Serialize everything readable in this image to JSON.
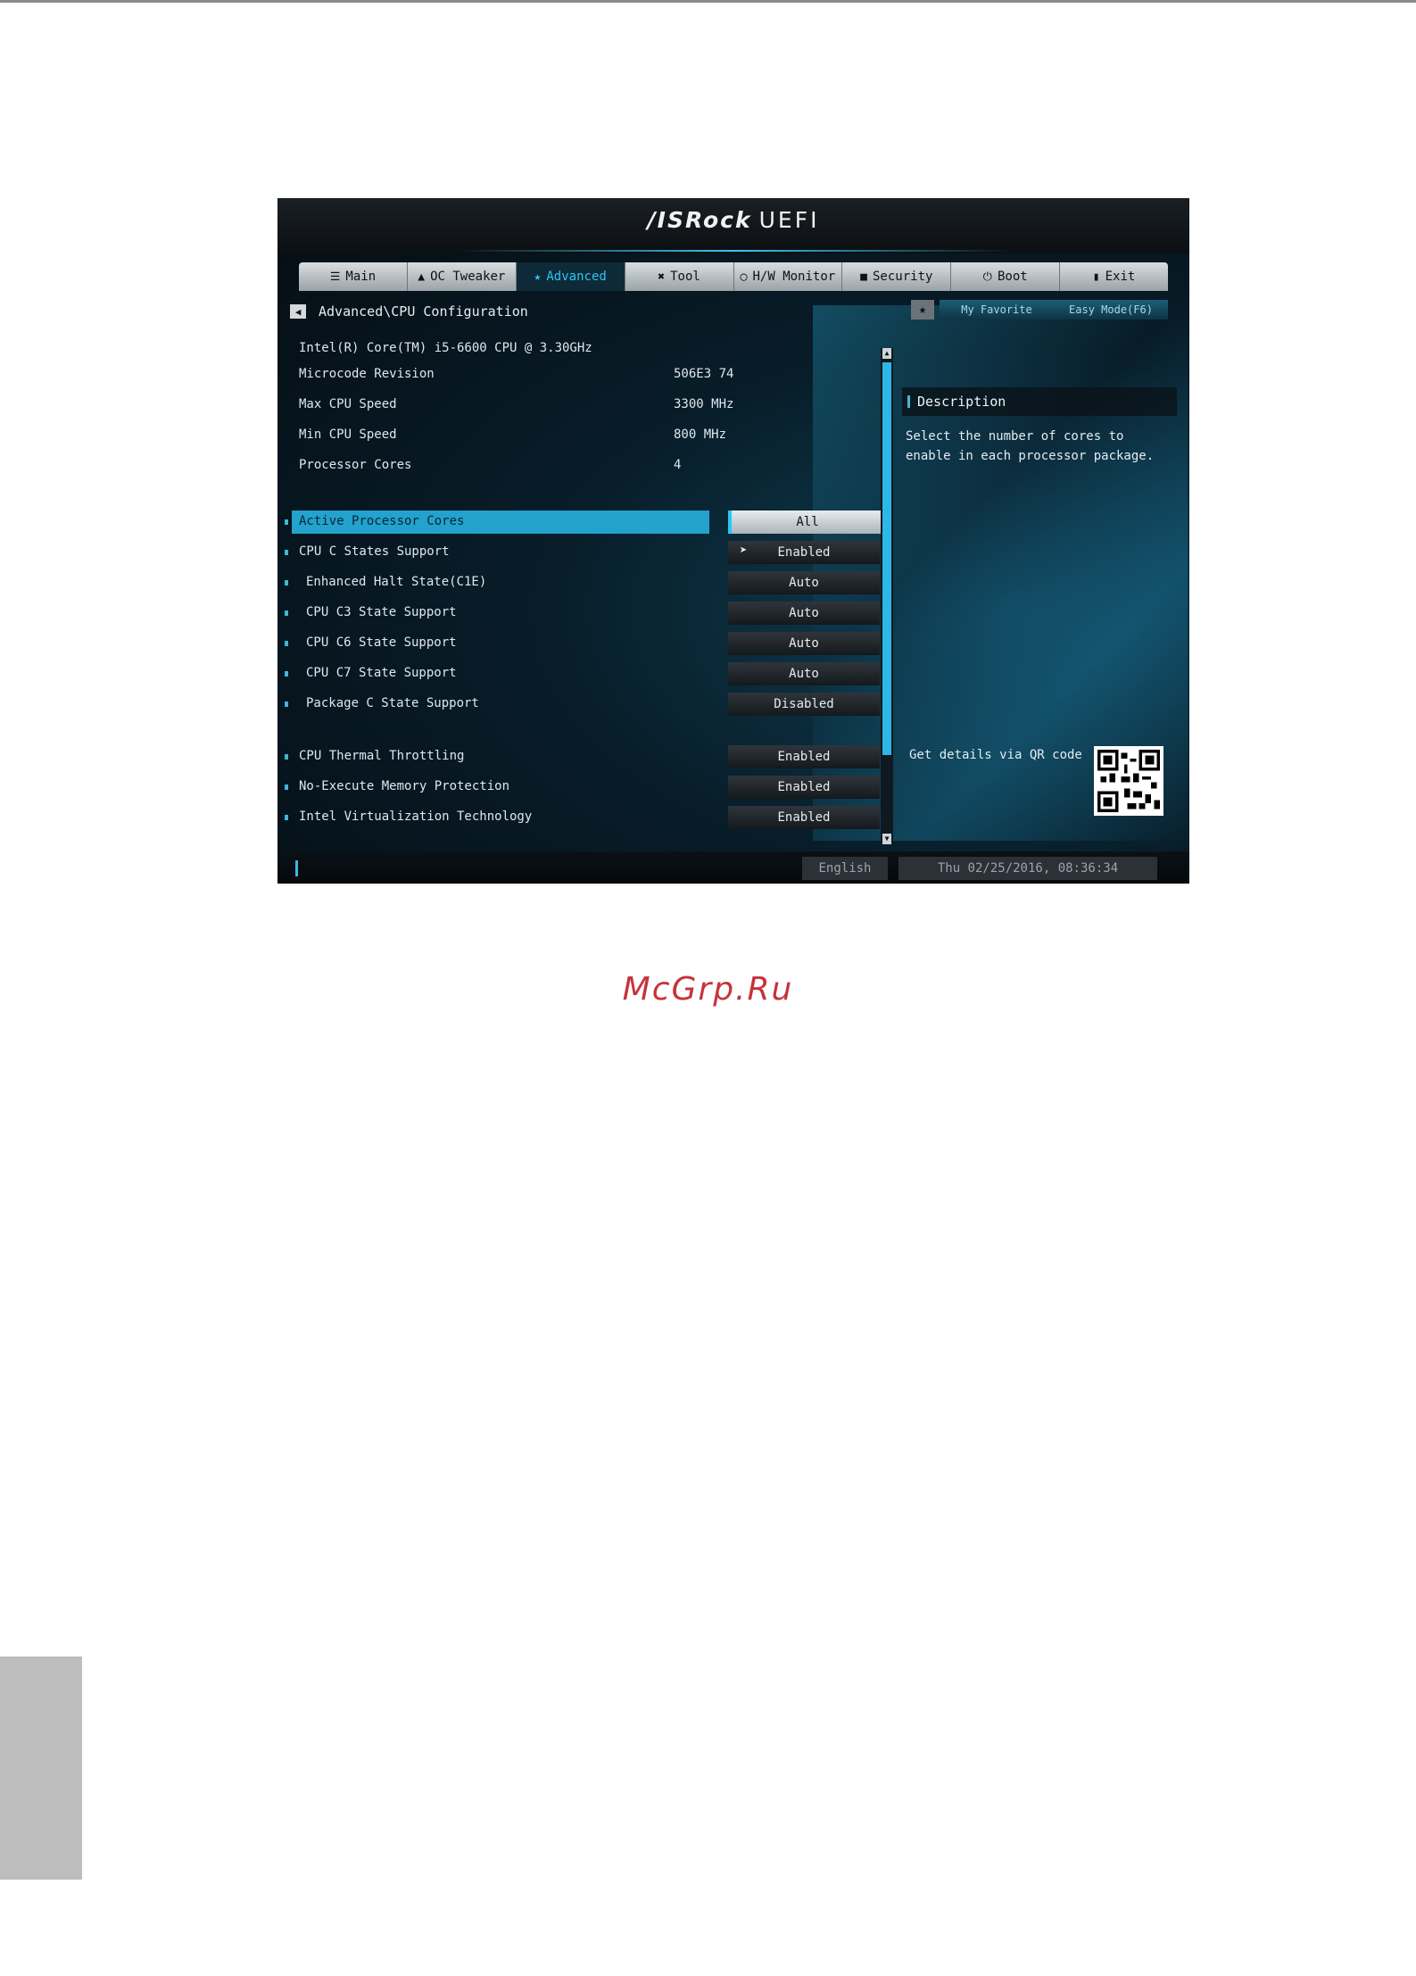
{
  "bios": {
    "brand": "/ISRock",
    "brand_suffix": "UEFI",
    "tabs": [
      {
        "icon": "list-icon",
        "label": "Main"
      },
      {
        "icon": "rocket-icon",
        "label": "OC Tweaker"
      },
      {
        "icon": "star-icon",
        "label": "Advanced"
      },
      {
        "icon": "tool-icon",
        "label": "Tool"
      },
      {
        "icon": "monitor-icon",
        "label": "H/W Monitor"
      },
      {
        "icon": "shield-icon",
        "label": "Security"
      },
      {
        "icon": "power-icon",
        "label": "Boot"
      },
      {
        "icon": "exit-icon",
        "label": "Exit"
      }
    ],
    "active_tab": "Advanced",
    "breadcrumb": "Advanced\\CPU Configuration",
    "my_favorite": "My Favorite",
    "easy_mode": "Easy Mode(F6)",
    "cpu_name": "Intel(R) Core(TM) i5-6600 CPU @ 3.30GHz",
    "info": [
      {
        "label": "Microcode Revision",
        "value": "506E3 74"
      },
      {
        "label": "Max CPU Speed",
        "value": "3300 MHz"
      },
      {
        "label": "Min CPU Speed",
        "value": "800 MHz"
      },
      {
        "label": "Processor Cores",
        "value": "4"
      }
    ],
    "settings": [
      {
        "label": "Active Processor Cores",
        "value": "All",
        "selected": true
      },
      {
        "label": "CPU C States Support",
        "value": "Enabled"
      },
      {
        "label": "Enhanced Halt State(C1E)",
        "value": "Auto"
      },
      {
        "label": "CPU C3 State Support",
        "value": "Auto"
      },
      {
        "label": "CPU C6 State Support",
        "value": "Auto"
      },
      {
        "label": "CPU C7 State Support",
        "value": "Auto"
      },
      {
        "label": "Package C State Support",
        "value": "Disabled"
      },
      {
        "label": "CPU Thermal Throttling",
        "value": "Enabled"
      },
      {
        "label": "No-Execute Memory Protection",
        "value": "Enabled"
      },
      {
        "label": "Intel Virtualization Technology",
        "value": "Enabled"
      }
    ],
    "description_title": "Description",
    "description_text": "Select the number of cores to enable in each processor package.",
    "qr_text": "Get details via QR code",
    "language": "English",
    "datetime": "Thu 02/25/2016, 08:36:34"
  },
  "watermark": "McGrp.Ru"
}
